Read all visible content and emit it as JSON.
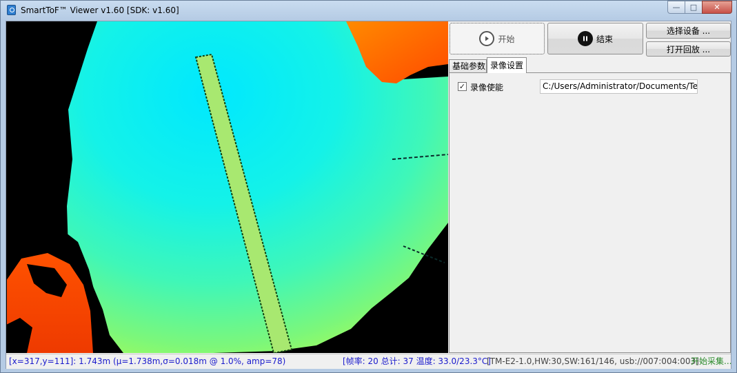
{
  "window": {
    "title": "SmartToF™ Viewer v1.60 [SDK: v1.60]",
    "minimize_glyph": "—",
    "maximize_glyph": "□",
    "close_glyph": "✕"
  },
  "toolbar": {
    "start_label": "开始",
    "stop_label": "结束",
    "select_device_label": "选择设备 ...",
    "open_playback_label": "打开回放 ..."
  },
  "tabs": [
    {
      "label": "基础参数",
      "active": false
    },
    {
      "label": "录像设置",
      "active": true
    }
  ],
  "recording": {
    "enable_label": "录像使能",
    "enable_checked": true,
    "check_glyph": "✓",
    "path_value": "C:/Users/Administrator/Documents/Ter"
  },
  "statusbar": {
    "cursor_info": "[x=317,y=111]: 1.743m (μ=1.738m,σ=0.018m @ 1.0%, amp=78)",
    "frame_info": "[帧率: 20 总计: 37 温度: 33.0/23.3°C]",
    "device_info": "[TM-E2-1.0,HW:30,SW:161/146, usb://007:004:003]",
    "state": "开始采集..."
  },
  "icons": {
    "app": "app-icon",
    "start": "play-circle-icon",
    "stop": "pause-circle-icon"
  },
  "colors": {
    "accent_start": "#555555",
    "status_blue": "#1a1acc",
    "status_green": "#2a8a2a",
    "depth_near": "#00e5ff",
    "depth_mid": "#40ffb0",
    "depth_far": "#ff5a00"
  }
}
